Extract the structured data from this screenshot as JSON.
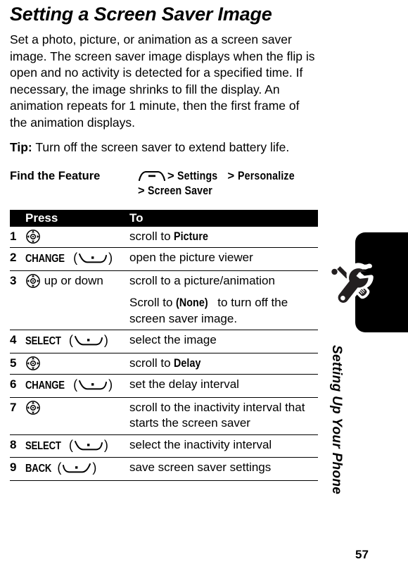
{
  "document": {
    "title": "Setting a Screen Saver Image",
    "intro_paragraph": "Set a photo, picture, or animation as a screen saver image. The screen saver image displays when the flip is open and no activity is detected for a specified time. If necessary, the image shrinks to fill the display. An animation repeats for 1 minute, then the first frame of the animation displays.",
    "tip_label": "Tip:",
    "tip_text": "Turn off the screen saver to extend battery life.",
    "page_number": "57"
  },
  "find_the_feature": {
    "label": "Find the Feature",
    "menu_key_icon": "menu-key-icon",
    "separator": ">",
    "path_line1_item1": "Settings",
    "path_line1_item2": "Personalize",
    "path_line2_item1": "Screen Saver"
  },
  "steps_table": {
    "headers": {
      "num": "",
      "press": "Press",
      "to": "To"
    },
    "rows": [
      {
        "num": "1",
        "press_icon": "navigation-key-icon",
        "press_key": "",
        "press_suffix": "",
        "to_text": "scroll to ",
        "to_emph": "Picture",
        "to_tail": "",
        "subnote_pre": "",
        "subnote_emph": "",
        "subnote_post": ""
      },
      {
        "num": "2",
        "press_icon": "left-soft-key-icon",
        "press_key": "CHANGE",
        "press_suffix": "",
        "to_text": "open the picture viewer",
        "to_emph": "",
        "to_tail": "",
        "subnote_pre": "",
        "subnote_emph": "",
        "subnote_post": ""
      },
      {
        "num": "3",
        "press_icon": "navigation-key-icon",
        "press_key": "",
        "press_suffix": " up or down",
        "to_text": "scroll to a picture/animation",
        "to_emph": "",
        "to_tail": "",
        "subnote_pre": "Scroll to ",
        "subnote_emph": "(None)",
        "subnote_post": " to turn off the screen saver image."
      },
      {
        "num": "4",
        "press_icon": "left-soft-key-icon",
        "press_key": "SELECT",
        "press_suffix": "",
        "to_text": "select the image",
        "to_emph": "",
        "to_tail": "",
        "subnote_pre": "",
        "subnote_emph": "",
        "subnote_post": ""
      },
      {
        "num": "5",
        "press_icon": "navigation-key-icon",
        "press_key": "",
        "press_suffix": "",
        "to_text": "scroll to ",
        "to_emph": "Delay",
        "to_tail": "",
        "subnote_pre": "",
        "subnote_emph": "",
        "subnote_post": ""
      },
      {
        "num": "6",
        "press_icon": "left-soft-key-icon",
        "press_key": "CHANGE",
        "press_suffix": "",
        "to_text": "set the delay interval",
        "to_emph": "",
        "to_tail": "",
        "subnote_pre": "",
        "subnote_emph": "",
        "subnote_post": ""
      },
      {
        "num": "7",
        "press_icon": "navigation-key-icon",
        "press_key": "",
        "press_suffix": "",
        "to_text": "scroll to the inactivity interval that starts the screen saver",
        "to_emph": "",
        "to_tail": "",
        "subnote_pre": "",
        "subnote_emph": "",
        "subnote_post": ""
      },
      {
        "num": "8",
        "press_icon": "left-soft-key-icon",
        "press_key": "SELECT",
        "press_suffix": "",
        "to_text": "select the inactivity interval",
        "to_emph": "",
        "to_tail": "",
        "subnote_pre": "",
        "subnote_emph": "",
        "subnote_post": ""
      },
      {
        "num": "9",
        "press_icon": "right-soft-key-icon",
        "press_key": "BACK",
        "press_suffix": "",
        "to_text": "save screen saver settings",
        "to_emph": "",
        "to_tail": "",
        "subnote_pre": "",
        "subnote_emph": "",
        "subnote_post": ""
      }
    ]
  },
  "sidebar": {
    "chapter_title": "Setting Up Your Phone",
    "tool_icon": "wrench-screwdriver-icon",
    "tab_color": "#000000"
  }
}
